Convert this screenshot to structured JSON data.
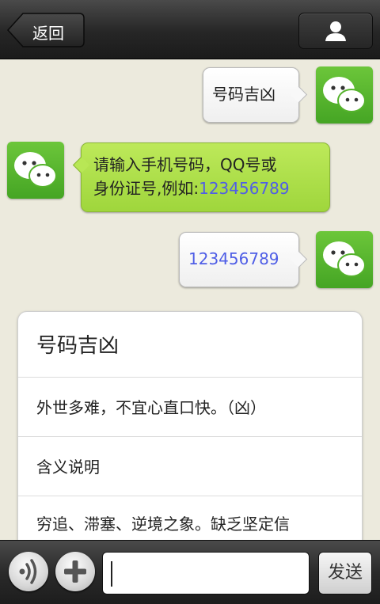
{
  "header": {
    "back_label": "返回",
    "profile_icon": "person-icon"
  },
  "messages": [
    {
      "side": "right",
      "text": "号码吉凶"
    },
    {
      "side": "left",
      "text_prefix": "请输入手机号码，QQ号或",
      "text_line2": "身份证号,例如:",
      "number": "123456789"
    },
    {
      "side": "right",
      "number": "123456789"
    }
  ],
  "result_card": {
    "title": "号码吉凶",
    "fortune": "外世多难，不宜心直口快。（凶）",
    "meaning_label": "含义说明",
    "description": "穷追、滞塞、逆境之象。缺乏坚定信"
  },
  "input_bar": {
    "voice_icon": "voice-icon",
    "add_icon": "plus-icon",
    "input_value": "",
    "send_label": "发送"
  },
  "colors": {
    "green_bubble": "#b0e24d",
    "number_text": "#4f5ee6",
    "avatar_green": "#55b32c"
  }
}
